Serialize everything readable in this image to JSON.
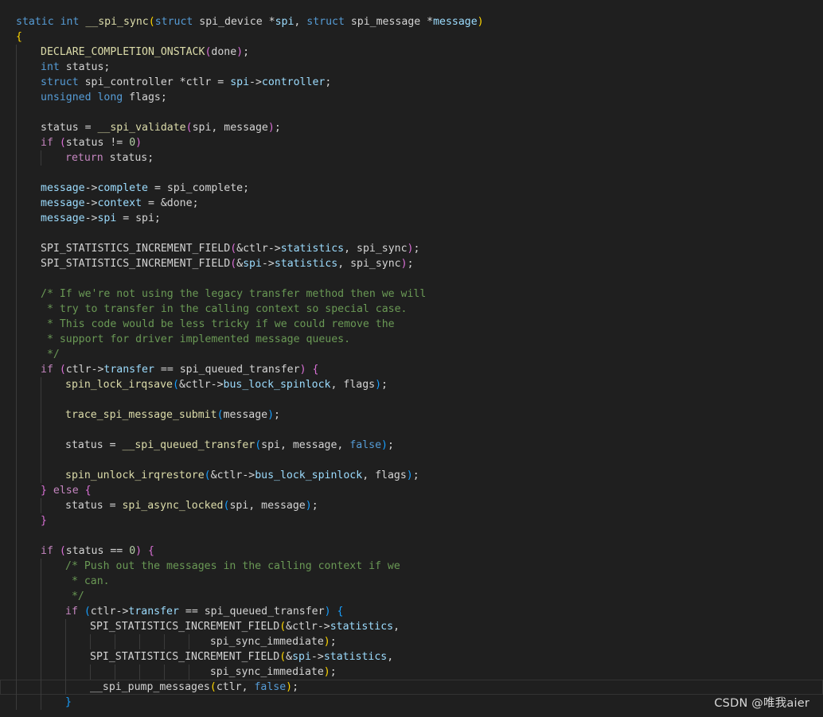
{
  "editor": {
    "lines": [
      {
        "indent": 0,
        "current": false,
        "tokens": [
          [
            "kw",
            "static "
          ],
          [
            "kw",
            "int "
          ],
          [
            "fn",
            "__spi_sync"
          ],
          [
            "b1",
            "("
          ],
          [
            "kw",
            "struct "
          ],
          [
            "pl",
            "spi_device *"
          ],
          [
            "var",
            "spi"
          ],
          [
            "pl",
            ", "
          ],
          [
            "kw",
            "struct "
          ],
          [
            "pl",
            "spi_message *"
          ],
          [
            "var",
            "message"
          ],
          [
            "b1",
            ")"
          ]
        ]
      },
      {
        "indent": 0,
        "current": false,
        "tokens": [
          [
            "b1",
            "{"
          ]
        ]
      },
      {
        "indent": 1,
        "current": false,
        "tokens": [
          [
            "fn",
            "DECLARE_COMPLETION_ONSTACK"
          ],
          [
            "b2",
            "("
          ],
          [
            "pl",
            "done"
          ],
          [
            "b2",
            ")"
          ],
          [
            "pl",
            ";"
          ]
        ]
      },
      {
        "indent": 1,
        "current": false,
        "tokens": [
          [
            "kw",
            "int "
          ],
          [
            "pl",
            "status;"
          ]
        ]
      },
      {
        "indent": 1,
        "current": false,
        "tokens": [
          [
            "kw",
            "struct "
          ],
          [
            "pl",
            "spi_controller *ctlr = "
          ],
          [
            "var",
            "spi"
          ],
          [
            "pl",
            "->"
          ],
          [
            "var",
            "controller"
          ],
          [
            "pl",
            ";"
          ]
        ]
      },
      {
        "indent": 1,
        "current": false,
        "tokens": [
          [
            "kw",
            "unsigned "
          ],
          [
            "kw",
            "long "
          ],
          [
            "pl",
            "flags;"
          ]
        ]
      },
      {
        "indent": 1,
        "current": false,
        "tokens": []
      },
      {
        "indent": 1,
        "current": false,
        "tokens": [
          [
            "pl",
            "status = "
          ],
          [
            "fn",
            "__spi_validate"
          ],
          [
            "b2",
            "("
          ],
          [
            "pl",
            "spi, message"
          ],
          [
            "b2",
            ")"
          ],
          [
            "pl",
            ";"
          ]
        ]
      },
      {
        "indent": 1,
        "current": false,
        "tokens": [
          [
            "ctl",
            "if "
          ],
          [
            "b2",
            "("
          ],
          [
            "pl",
            "status != "
          ],
          [
            "num",
            "0"
          ],
          [
            "b2",
            ")"
          ]
        ]
      },
      {
        "indent": 2,
        "current": false,
        "tokens": [
          [
            "ctl",
            "return "
          ],
          [
            "pl",
            "status;"
          ]
        ]
      },
      {
        "indent": 1,
        "current": false,
        "tokens": []
      },
      {
        "indent": 1,
        "current": false,
        "tokens": [
          [
            "var",
            "message"
          ],
          [
            "pl",
            "->"
          ],
          [
            "var",
            "complete"
          ],
          [
            "pl",
            " = spi_complete;"
          ]
        ]
      },
      {
        "indent": 1,
        "current": false,
        "tokens": [
          [
            "var",
            "message"
          ],
          [
            "pl",
            "->"
          ],
          [
            "var",
            "context"
          ],
          [
            "pl",
            " = &done;"
          ]
        ]
      },
      {
        "indent": 1,
        "current": false,
        "tokens": [
          [
            "var",
            "message"
          ],
          [
            "pl",
            "->"
          ],
          [
            "var",
            "spi"
          ],
          [
            "pl",
            " = spi;"
          ]
        ]
      },
      {
        "indent": 1,
        "current": false,
        "tokens": []
      },
      {
        "indent": 1,
        "current": false,
        "tokens": [
          [
            "pl",
            "SPI_STATISTICS_INCREMENT_FIELD"
          ],
          [
            "b2",
            "("
          ],
          [
            "pl",
            "&ctlr->"
          ],
          [
            "var",
            "statistics"
          ],
          [
            "pl",
            ", spi_sync"
          ],
          [
            "b2",
            ")"
          ],
          [
            "pl",
            ";"
          ]
        ]
      },
      {
        "indent": 1,
        "current": false,
        "tokens": [
          [
            "pl",
            "SPI_STATISTICS_INCREMENT_FIELD"
          ],
          [
            "b2",
            "("
          ],
          [
            "pl",
            "&"
          ],
          [
            "var",
            "spi"
          ],
          [
            "pl",
            "->"
          ],
          [
            "var",
            "statistics"
          ],
          [
            "pl",
            ", spi_sync"
          ],
          [
            "b2",
            ")"
          ],
          [
            "pl",
            ";"
          ]
        ]
      },
      {
        "indent": 1,
        "current": false,
        "tokens": []
      },
      {
        "indent": 1,
        "current": false,
        "tokens": [
          [
            "cmt",
            "/* If we're not using the legacy transfer method then we will"
          ]
        ]
      },
      {
        "indent": 1,
        "current": false,
        "tokens": [
          [
            "cmt",
            " * try to transfer in the calling context so special case."
          ]
        ]
      },
      {
        "indent": 1,
        "current": false,
        "tokens": [
          [
            "cmt",
            " * This code would be less tricky if we could remove the"
          ]
        ]
      },
      {
        "indent": 1,
        "current": false,
        "tokens": [
          [
            "cmt",
            " * support for driver implemented message queues."
          ]
        ]
      },
      {
        "indent": 1,
        "current": false,
        "tokens": [
          [
            "cmt",
            " */"
          ]
        ]
      },
      {
        "indent": 1,
        "current": false,
        "tokens": [
          [
            "ctl",
            "if "
          ],
          [
            "b2",
            "("
          ],
          [
            "pl",
            "ctlr->"
          ],
          [
            "var",
            "transfer"
          ],
          [
            "pl",
            " == spi_queued_transfer"
          ],
          [
            "b2",
            ")"
          ],
          [
            "pl",
            " "
          ],
          [
            "b2",
            "{"
          ]
        ]
      },
      {
        "indent": 2,
        "current": false,
        "tokens": [
          [
            "fn",
            "spin_lock_irqsave"
          ],
          [
            "b3",
            "("
          ],
          [
            "pl",
            "&ctlr->"
          ],
          [
            "var",
            "bus_lock_spinlock"
          ],
          [
            "pl",
            ", flags"
          ],
          [
            "b3",
            ")"
          ],
          [
            "pl",
            ";"
          ]
        ]
      },
      {
        "indent": 2,
        "current": false,
        "tokens": []
      },
      {
        "indent": 2,
        "current": false,
        "tokens": [
          [
            "fn",
            "trace_spi_message_submit"
          ],
          [
            "b3",
            "("
          ],
          [
            "pl",
            "message"
          ],
          [
            "b3",
            ")"
          ],
          [
            "pl",
            ";"
          ]
        ]
      },
      {
        "indent": 2,
        "current": false,
        "tokens": []
      },
      {
        "indent": 2,
        "current": false,
        "tokens": [
          [
            "pl",
            "status = "
          ],
          [
            "fn",
            "__spi_queued_transfer"
          ],
          [
            "b3",
            "("
          ],
          [
            "pl",
            "spi, message, "
          ],
          [
            "kw",
            "false"
          ],
          [
            "b3",
            ")"
          ],
          [
            "pl",
            ";"
          ]
        ]
      },
      {
        "indent": 2,
        "current": false,
        "tokens": []
      },
      {
        "indent": 2,
        "current": false,
        "tokens": [
          [
            "fn",
            "spin_unlock_irqrestore"
          ],
          [
            "b3",
            "("
          ],
          [
            "pl",
            "&ctlr->"
          ],
          [
            "var",
            "bus_lock_spinlock"
          ],
          [
            "pl",
            ", flags"
          ],
          [
            "b3",
            ")"
          ],
          [
            "pl",
            ";"
          ]
        ]
      },
      {
        "indent": 1,
        "current": false,
        "tokens": [
          [
            "b2",
            "}"
          ],
          [
            "pl",
            " "
          ],
          [
            "ctl",
            "else "
          ],
          [
            "b2",
            "{"
          ]
        ]
      },
      {
        "indent": 2,
        "current": false,
        "tokens": [
          [
            "pl",
            "status = "
          ],
          [
            "fn",
            "spi_async_locked"
          ],
          [
            "b3",
            "("
          ],
          [
            "pl",
            "spi, message"
          ],
          [
            "b3",
            ")"
          ],
          [
            "pl",
            ";"
          ]
        ]
      },
      {
        "indent": 1,
        "current": false,
        "tokens": [
          [
            "b2",
            "}"
          ]
        ]
      },
      {
        "indent": 1,
        "current": false,
        "tokens": []
      },
      {
        "indent": 1,
        "current": false,
        "tokens": [
          [
            "ctl",
            "if "
          ],
          [
            "b2",
            "("
          ],
          [
            "pl",
            "status == "
          ],
          [
            "num",
            "0"
          ],
          [
            "b2",
            ")"
          ],
          [
            "pl",
            " "
          ],
          [
            "b2",
            "{"
          ]
        ]
      },
      {
        "indent": 2,
        "current": false,
        "tokens": [
          [
            "cmt",
            "/* Push out the messages in the calling context if we"
          ]
        ]
      },
      {
        "indent": 2,
        "current": false,
        "tokens": [
          [
            "cmt",
            " * can."
          ]
        ]
      },
      {
        "indent": 2,
        "current": false,
        "tokens": [
          [
            "cmt",
            " */"
          ]
        ]
      },
      {
        "indent": 2,
        "current": false,
        "tokens": [
          [
            "ctl",
            "if "
          ],
          [
            "b3",
            "("
          ],
          [
            "pl",
            "ctlr->"
          ],
          [
            "var",
            "transfer"
          ],
          [
            "pl",
            " == spi_queued_transfer"
          ],
          [
            "b3",
            ")"
          ],
          [
            "pl",
            " "
          ],
          [
            "b3",
            "{"
          ]
        ]
      },
      {
        "indent": 3,
        "current": false,
        "tokens": [
          [
            "pl",
            "SPI_STATISTICS_INCREMENT_FIELD"
          ],
          [
            "b1",
            "("
          ],
          [
            "pl",
            "&ctlr->"
          ],
          [
            "var",
            "statistics"
          ],
          [
            "pl",
            ","
          ]
        ]
      },
      {
        "indent": 8,
        "current": false,
        "tokens": [
          [
            "pl",
            "                   spi_sync_immediate"
          ],
          [
            "b1",
            ")"
          ],
          [
            "pl",
            ";"
          ]
        ]
      },
      {
        "indent": 3,
        "current": false,
        "tokens": [
          [
            "pl",
            "SPI_STATISTICS_INCREMENT_FIELD"
          ],
          [
            "b1",
            "("
          ],
          [
            "pl",
            "&"
          ],
          [
            "var",
            "spi"
          ],
          [
            "pl",
            "->"
          ],
          [
            "var",
            "statistics"
          ],
          [
            "pl",
            ","
          ]
        ]
      },
      {
        "indent": 8,
        "current": false,
        "tokens": [
          [
            "pl",
            "                   spi_sync_immediate"
          ],
          [
            "b1",
            ")"
          ],
          [
            "pl",
            ";"
          ]
        ]
      },
      {
        "indent": 3,
        "current": true,
        "tokens": [
          [
            "pl",
            "__spi_pump_messages"
          ],
          [
            "b1",
            "("
          ],
          [
            "pl",
            "ctlr, "
          ],
          [
            "kw",
            "false"
          ],
          [
            "b1",
            ")"
          ],
          [
            "pl",
            ";"
          ]
        ]
      },
      {
        "indent": 2,
        "current": false,
        "tokens": [
          [
            "b3",
            "}"
          ]
        ]
      }
    ]
  },
  "watermark": {
    "text": "CSDN @唯我aier"
  }
}
